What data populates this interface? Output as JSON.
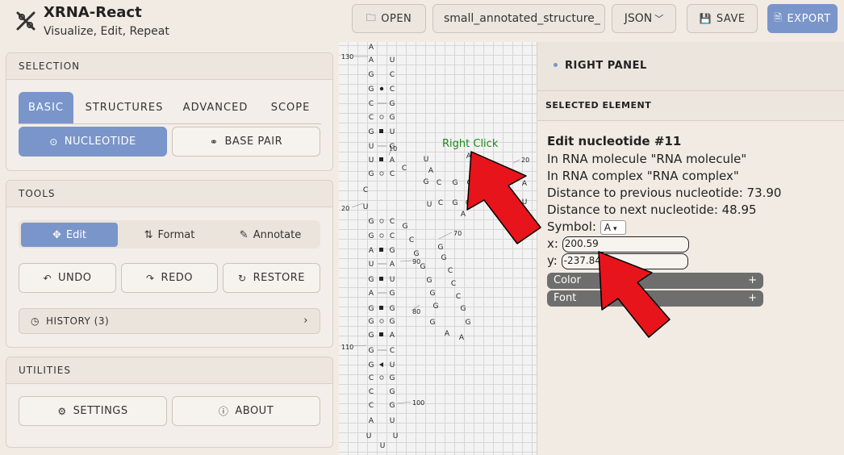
{
  "app": {
    "title": "XRNA-React",
    "subtitle": "Visualize, Edit, Repeat"
  },
  "header": {
    "open_label": "OPEN",
    "file_name": "small_annotated_structure_",
    "format_label": "JSON",
    "save_label": "SAVE",
    "export_label": "EXPORT"
  },
  "selection": {
    "heading": "SELECTION",
    "tabs": [
      "BASIC",
      "STRUCTURES",
      "ADVANCED",
      "SCOPE"
    ],
    "nucleotide_label": "NUCLEOTIDE",
    "base_pair_label": "BASE PAIR"
  },
  "tools": {
    "heading": "TOOLS",
    "edit_label": "Edit",
    "format_label": "Format",
    "annotate_label": "Annotate",
    "undo_label": "UNDO",
    "redo_label": "REDO",
    "restore_label": "RESTORE",
    "history_label": "HISTORY (3)"
  },
  "utilities": {
    "heading": "UTILITIES",
    "settings_label": "SETTINGS",
    "about_label": "ABOUT"
  },
  "canvas": {
    "annotation": "Right Click",
    "position_labels": [
      "130",
      "10",
      "20",
      "20",
      "70",
      "90",
      "80",
      "110",
      "100"
    ]
  },
  "right_panel": {
    "title": "RIGHT PANEL",
    "section": "SELECTED ELEMENT",
    "heading": "Edit nucleotide #11",
    "molecule_line": "In RNA molecule \"RNA molecule\"",
    "complex_line": "In RNA complex \"RNA complex\"",
    "prev_distance_line": "Distance to previous nucleotide: 73.90",
    "next_distance_line": "Distance to next nucleotide: 48.95",
    "symbol_label": "Symbol:",
    "symbol_value": "A",
    "x_label": "x:",
    "x_value": "200.59",
    "y_label": "y:",
    "y_value": "-237.84",
    "color_label": "Color",
    "font_label": "Font"
  },
  "colors": {
    "accent": "#7a95c9",
    "annotation_arrow": "#e8141b",
    "annotation_text": "#1a8a1a"
  }
}
